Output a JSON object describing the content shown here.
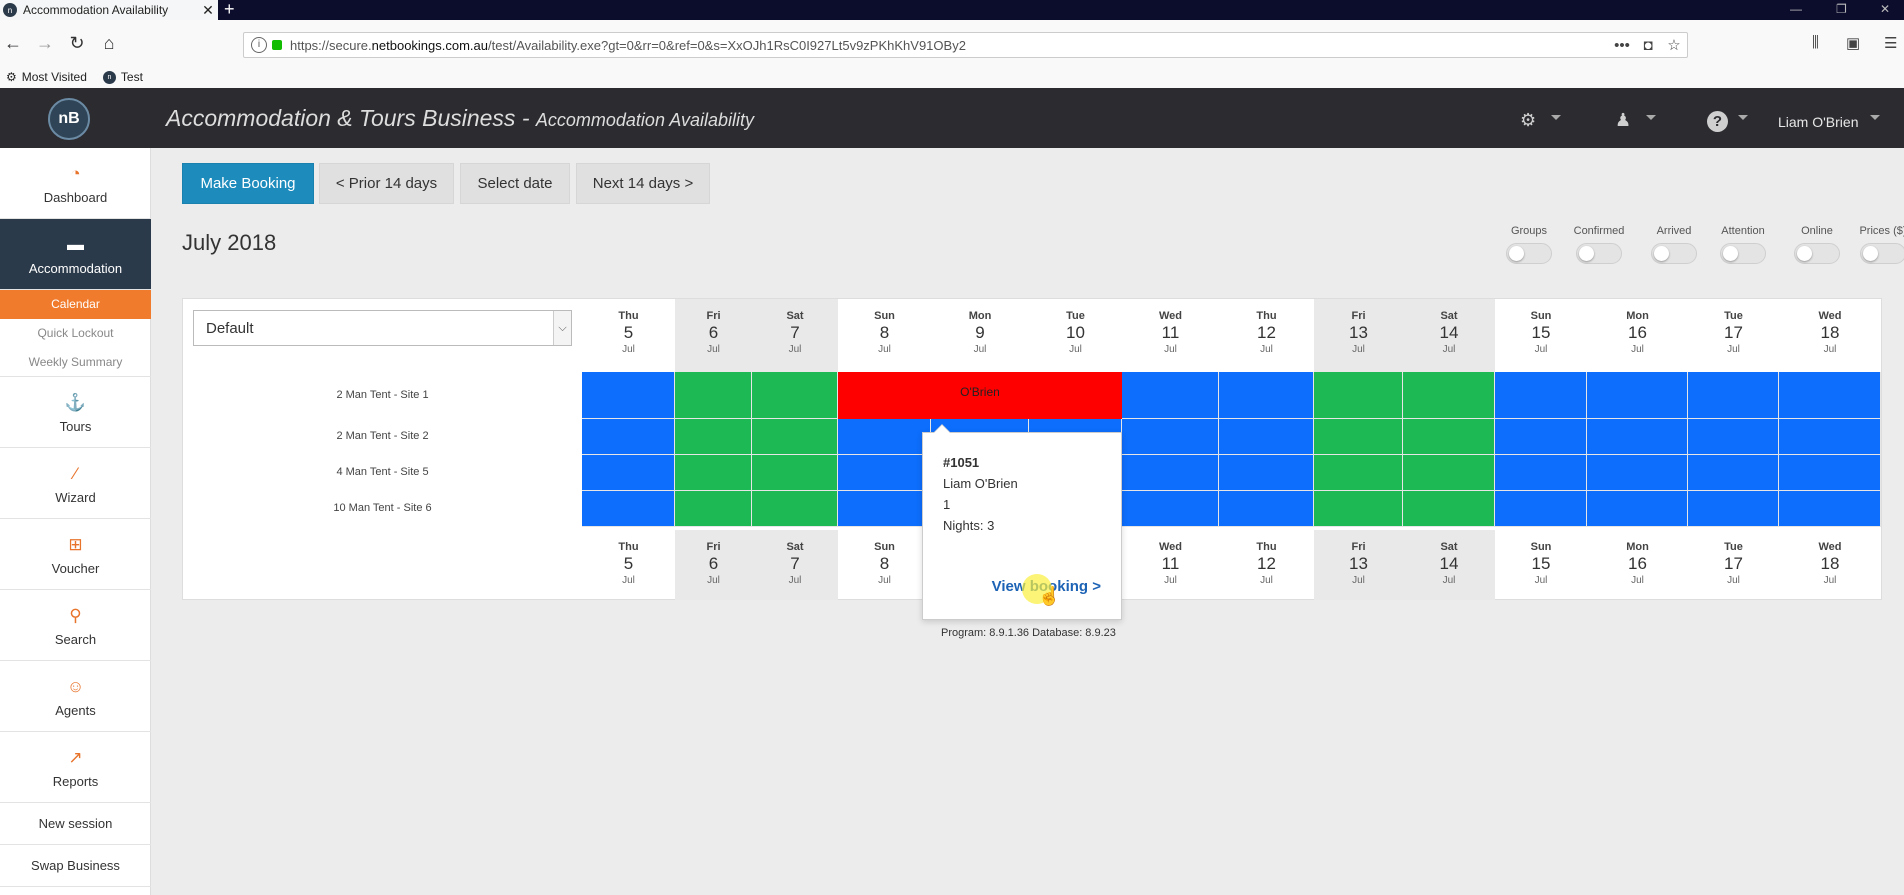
{
  "browser": {
    "tab_title": "Accommodation Availability",
    "tab_icon_text": "n",
    "url_prefix": "https://secure.",
    "url_domain": "netbookings.com.au",
    "url_path": "/test/Availability.exe?gt=0&rr=0&ref=0&s=XxOJh1RsC0I927Lt5v9zPKhKhV91OBy2",
    "bookmarks": [
      "Most Visited",
      "Test"
    ]
  },
  "header": {
    "logo": "nB",
    "title": "Accommodation & Tours Business",
    "separator": " - ",
    "subtitle": "Accommodation Availability",
    "user": "Liam O'Brien"
  },
  "sidebar": {
    "items": [
      {
        "label": "Dashboard",
        "icon": "dashboard-icon"
      },
      {
        "label": "Accommodation",
        "icon": "bed-icon"
      },
      {
        "label": "Tours",
        "icon": "tours-icon"
      },
      {
        "label": "Wizard",
        "icon": "wand-icon"
      },
      {
        "label": "Voucher",
        "icon": "gift-icon"
      },
      {
        "label": "Search",
        "icon": "search-icon"
      },
      {
        "label": "Agents",
        "icon": "agent-icon"
      },
      {
        "label": "Reports",
        "icon": "chart-icon"
      }
    ],
    "subitems": [
      "Calendar",
      "Quick Lockout",
      "Weekly Summary"
    ],
    "footer": [
      "New session",
      "Swap Business"
    ]
  },
  "toolbar": {
    "make_booking": "Make Booking",
    "prior": "< Prior 14 days",
    "select_date": "Select date",
    "next": "Next 14 days >"
  },
  "month_title": "July 2018",
  "filters": [
    "Groups",
    "Confirmed",
    "Arrived",
    "Attention",
    "Online",
    "Prices ($)"
  ],
  "view_select": "Default",
  "days": [
    {
      "dow": "Thu",
      "num": "5",
      "mon": "Jul"
    },
    {
      "dow": "Fri",
      "num": "6",
      "mon": "Jul"
    },
    {
      "dow": "Sat",
      "num": "7",
      "mon": "Jul"
    },
    {
      "dow": "Sun",
      "num": "8",
      "mon": "Jul"
    },
    {
      "dow": "Mon",
      "num": "9",
      "mon": "Jul"
    },
    {
      "dow": "Tue",
      "num": "10",
      "mon": "Jul"
    },
    {
      "dow": "Wed",
      "num": "11",
      "mon": "Jul"
    },
    {
      "dow": "Thu",
      "num": "12",
      "mon": "Jul"
    },
    {
      "dow": "Fri",
      "num": "13",
      "mon": "Jul"
    },
    {
      "dow": "Sat",
      "num": "14",
      "mon": "Jul"
    },
    {
      "dow": "Sun",
      "num": "15",
      "mon": "Jul"
    },
    {
      "dow": "Mon",
      "num": "16",
      "mon": "Jul"
    },
    {
      "dow": "Tue",
      "num": "17",
      "mon": "Jul"
    },
    {
      "dow": "Wed",
      "num": "18",
      "mon": "Jul"
    }
  ],
  "sites": [
    "2 Man Tent - Site 1",
    "2 Man Tent - Site 2",
    "4 Man Tent - Site 5",
    "10 Man Tent - Site 6"
  ],
  "colors": {
    "available": "#0d6efd",
    "weekend": "#1cb954",
    "booked": "#ff0000"
  },
  "booking_label": "O'Brien",
  "popup": {
    "ref": "#1051",
    "guest": "Liam O'Brien",
    "qty": "1",
    "nights": "Nights: 3",
    "view": "View booking >"
  },
  "version": "Program: 8.9.1.36 Database: 8.9.23"
}
